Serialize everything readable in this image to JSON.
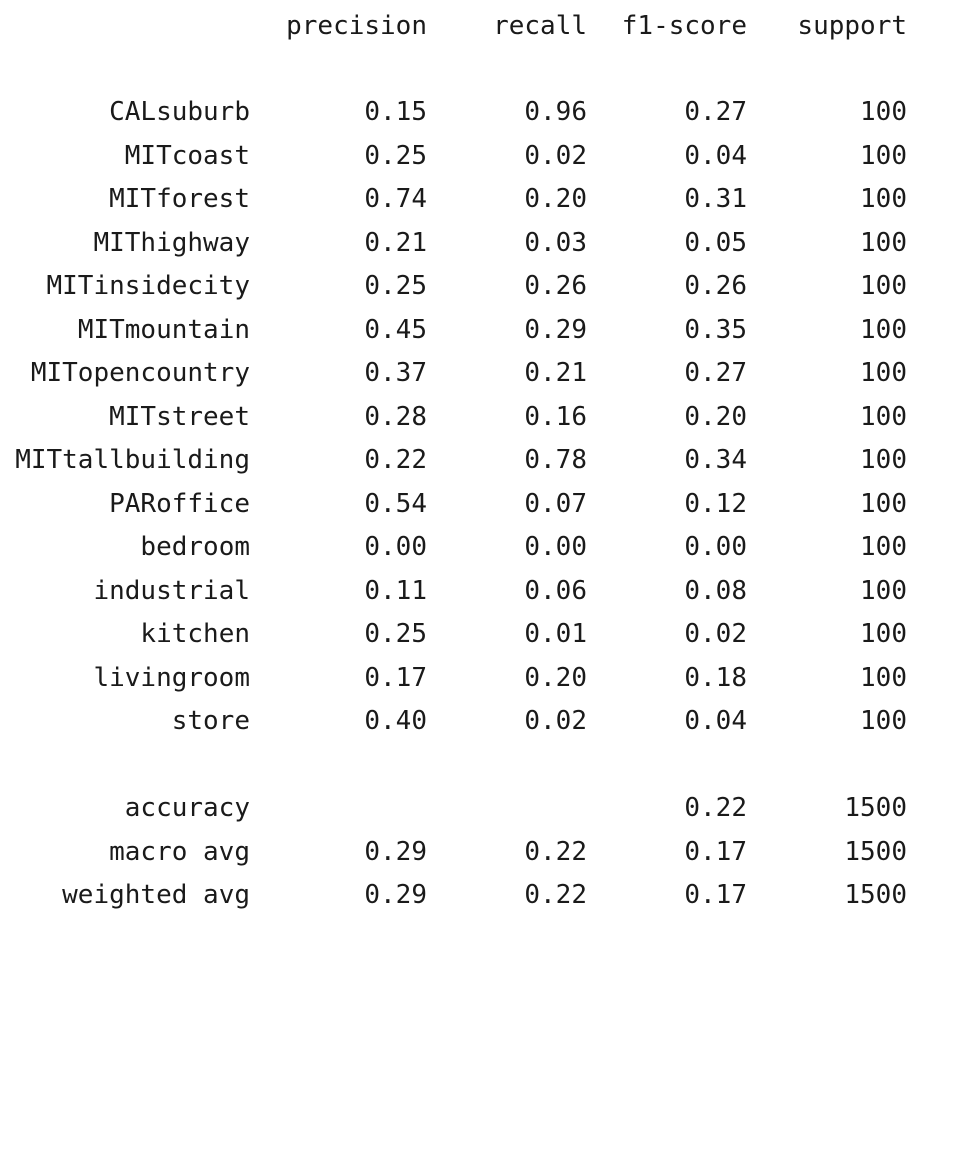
{
  "report": {
    "headers": {
      "precision": "precision",
      "recall": "recall",
      "f1": "f1-score",
      "support": "support"
    },
    "classes": [
      {
        "label": "CALsuburb",
        "precision": "0.15",
        "recall": "0.96",
        "f1": "0.27",
        "support": "100"
      },
      {
        "label": "MITcoast",
        "precision": "0.25",
        "recall": "0.02",
        "f1": "0.04",
        "support": "100"
      },
      {
        "label": "MITforest",
        "precision": "0.74",
        "recall": "0.20",
        "f1": "0.31",
        "support": "100"
      },
      {
        "label": "MIThighway",
        "precision": "0.21",
        "recall": "0.03",
        "f1": "0.05",
        "support": "100"
      },
      {
        "label": "MITinsidecity",
        "precision": "0.25",
        "recall": "0.26",
        "f1": "0.26",
        "support": "100"
      },
      {
        "label": "MITmountain",
        "precision": "0.45",
        "recall": "0.29",
        "f1": "0.35",
        "support": "100"
      },
      {
        "label": "MITopencountry",
        "precision": "0.37",
        "recall": "0.21",
        "f1": "0.27",
        "support": "100"
      },
      {
        "label": "MITstreet",
        "precision": "0.28",
        "recall": "0.16",
        "f1": "0.20",
        "support": "100"
      },
      {
        "label": "MITtallbuilding",
        "precision": "0.22",
        "recall": "0.78",
        "f1": "0.34",
        "support": "100"
      },
      {
        "label": "PARoffice",
        "precision": "0.54",
        "recall": "0.07",
        "f1": "0.12",
        "support": "100"
      },
      {
        "label": "bedroom",
        "precision": "0.00",
        "recall": "0.00",
        "f1": "0.00",
        "support": "100"
      },
      {
        "label": "industrial",
        "precision": "0.11",
        "recall": "0.06",
        "f1": "0.08",
        "support": "100"
      },
      {
        "label": "kitchen",
        "precision": "0.25",
        "recall": "0.01",
        "f1": "0.02",
        "support": "100"
      },
      {
        "label": "livingroom",
        "precision": "0.17",
        "recall": "0.20",
        "f1": "0.18",
        "support": "100"
      },
      {
        "label": "store",
        "precision": "0.40",
        "recall": "0.02",
        "f1": "0.04",
        "support": "100"
      }
    ],
    "summary": [
      {
        "label": "accuracy",
        "precision": "",
        "recall": "",
        "f1": "0.22",
        "support": "1500"
      },
      {
        "label": "macro avg",
        "precision": "0.29",
        "recall": "0.22",
        "f1": "0.17",
        "support": "1500"
      },
      {
        "label": "weighted avg",
        "precision": "0.29",
        "recall": "0.22",
        "f1": "0.17",
        "support": "1500"
      }
    ]
  }
}
